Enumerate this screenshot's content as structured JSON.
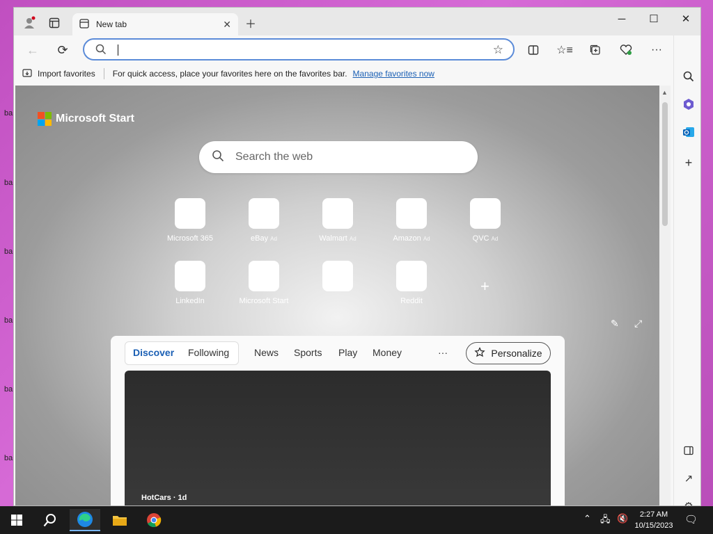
{
  "desktop": {
    "labels": [
      "ba",
      "ba",
      "ba",
      "ba",
      "ba",
      "ba"
    ]
  },
  "browser": {
    "tab": {
      "title": "New tab"
    },
    "address": {
      "value": "",
      "placeholder": ""
    },
    "favorites_bar": {
      "import_label": "Import favorites",
      "hint": "For quick access, place your favorites here on the favorites bar.",
      "manage_link": "Manage favorites now"
    }
  },
  "newtab": {
    "brand": "Microsoft Start",
    "search_placeholder": "Search the web",
    "quick_links": [
      {
        "label": "Microsoft 365",
        "ad": ""
      },
      {
        "label": "eBay",
        "ad": "Ad"
      },
      {
        "label": "Walmart",
        "ad": "Ad"
      },
      {
        "label": "Amazon",
        "ad": "Ad"
      },
      {
        "label": "QVC",
        "ad": "Ad"
      },
      {
        "label": "LinkedIn",
        "ad": ""
      },
      {
        "label": "Microsoft Start",
        "ad": ""
      },
      {
        "label": "",
        "ad": ""
      },
      {
        "label": "Reddit",
        "ad": ""
      }
    ],
    "feed": {
      "tabs": [
        "Discover",
        "Following",
        "News",
        "Sports",
        "Play",
        "Money"
      ],
      "more": "···",
      "personalize": "Personalize",
      "card": {
        "source": "HotCars · 1d",
        "headline": ""
      }
    }
  },
  "taskbar": {
    "time": "2:27 AM",
    "date": "10/15/2023"
  },
  "colors": {
    "accent": "#1a5fb4",
    "taskbar": "#1b1b1b",
    "desktop": "#c04fc0"
  }
}
